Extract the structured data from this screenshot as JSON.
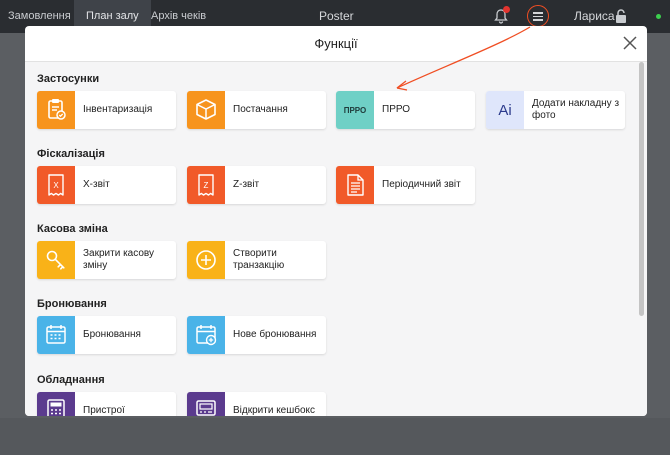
{
  "topbar": {
    "tabs": [
      "Замовлення",
      "План залу",
      "Архів чеків"
    ],
    "brand": "Poster",
    "user": "Лариса",
    "colors": {
      "accent": "#f04e23",
      "online": "#3ccf4e",
      "badge": "#e3342f"
    }
  },
  "modal": {
    "title": "Функції",
    "sections": [
      {
        "title": "Застосунки",
        "items": [
          {
            "label": "Інвентаризація",
            "icon": "clipboard-icon",
            "color": "#f7941d"
          },
          {
            "label": "Постачання",
            "icon": "box-icon",
            "color": "#f7941d"
          },
          {
            "label": "ПРРО",
            "icon": "prro-icon",
            "icon_text": "ПРРО",
            "color": "#6fd0c6"
          },
          {
            "label": "Додати накладну з фото",
            "icon": "ai-icon",
            "icon_text": "Ai",
            "color": "#dfe6fb"
          }
        ]
      },
      {
        "title": "Фіскалізація",
        "items": [
          {
            "label": "X-звіт",
            "icon": "x-receipt-icon",
            "icon_text": "X",
            "color": "#f15a29"
          },
          {
            "label": "Z-звіт",
            "icon": "z-receipt-icon",
            "icon_text": "Z",
            "color": "#f15a29"
          },
          {
            "label": "Періодичний звіт",
            "icon": "document-icon",
            "color": "#f15a29"
          }
        ]
      },
      {
        "title": "Касова зміна",
        "items": [
          {
            "label": "Закрити касову зміну",
            "icon": "key-icon",
            "color": "#f9b218"
          },
          {
            "label": "Створити транзакцію",
            "icon": "plus-circle-icon",
            "color": "#f9b218"
          }
        ]
      },
      {
        "title": "Бронювання",
        "items": [
          {
            "label": "Бронювання",
            "icon": "calendar-icon",
            "color": "#4ab3e8"
          },
          {
            "label": "Нове бронювання",
            "icon": "calendar-plus-icon",
            "color": "#4ab3e8"
          }
        ]
      },
      {
        "title": "Обладнання",
        "items": [
          {
            "label": "Пристрої",
            "icon": "calculator-icon",
            "color": "#5b3b8e"
          },
          {
            "label": "Відкрити кешбокс",
            "icon": "cashbox-icon",
            "color": "#5b3b8e"
          }
        ]
      }
    ]
  }
}
